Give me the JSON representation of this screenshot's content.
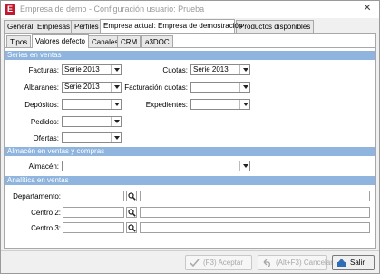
{
  "window": {
    "title": "Empresa de demo - Configuración usuario: Prueba",
    "icon_letter": "E"
  },
  "main_tabs": [
    "General",
    "Empresas",
    "Perfiles",
    "Empresa actual:  Empresa de demostración",
    "Productos disponibles"
  ],
  "sub_tabs": [
    "Tipos",
    "Valores defecto",
    "Canales",
    "CRM",
    "a3DOC"
  ],
  "sections": {
    "ventas": "Series en ventas",
    "almacen": "Almacén en ventas y compras",
    "analitica": "Analítica en ventas"
  },
  "series_ventas": {
    "facturas": {
      "label": "Facturas:",
      "value": "Serie  2013"
    },
    "albaranes": {
      "label": "Albaranes:",
      "value": "Serie  2013"
    },
    "depositos": {
      "label": "Depósitos:",
      "value": ""
    },
    "pedidos": {
      "label": "Pedidos:",
      "value": ""
    },
    "ofertas": {
      "label": "Ofertas:",
      "value": ""
    },
    "cuotas": {
      "label": "Cuotas:",
      "value": "Serie  2013"
    },
    "facturacion_cuotas": {
      "label": "Facturación cuotas:",
      "value": ""
    },
    "expedientes": {
      "label": "Expedientes:",
      "value": ""
    }
  },
  "almacen": {
    "label": "Almacén:",
    "value": ""
  },
  "analitica": {
    "departamento": {
      "label": "Departamento:",
      "code": "",
      "description": ""
    },
    "centro2": {
      "label": "Centro 2:",
      "code": "",
      "description": ""
    },
    "centro3": {
      "label": "Centro 3:",
      "code": "",
      "description": ""
    }
  },
  "footer": {
    "accept": "(F3) Aceptar",
    "cancel": "(Alt+F3) Cancelar",
    "exit": "Salir"
  },
  "colors": {
    "section_header": "#8fb5de",
    "app_icon": "#c0182e"
  }
}
